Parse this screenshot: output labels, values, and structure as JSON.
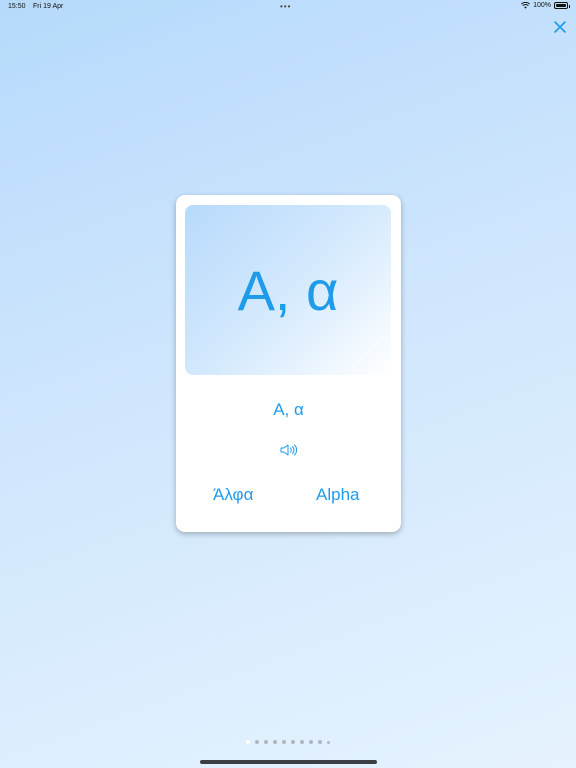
{
  "status_bar": {
    "time": "15:50",
    "date": "Fri 19 Apr",
    "multitask_dots": "•••",
    "battery": "100%"
  },
  "card": {
    "display_letter": "Α, α",
    "letter_label": "Α, α",
    "speaker_icon": "speaker-icon",
    "word_greek": "Άλφα",
    "word_latin": "Alpha"
  },
  "pager": {
    "total_pages": 10,
    "current_page": 1
  },
  "colors": {
    "accent": "#1e9be9",
    "card_bg": "#ffffff",
    "background_top": "#b6dafb",
    "background_bottom": "#e6f3fe"
  }
}
